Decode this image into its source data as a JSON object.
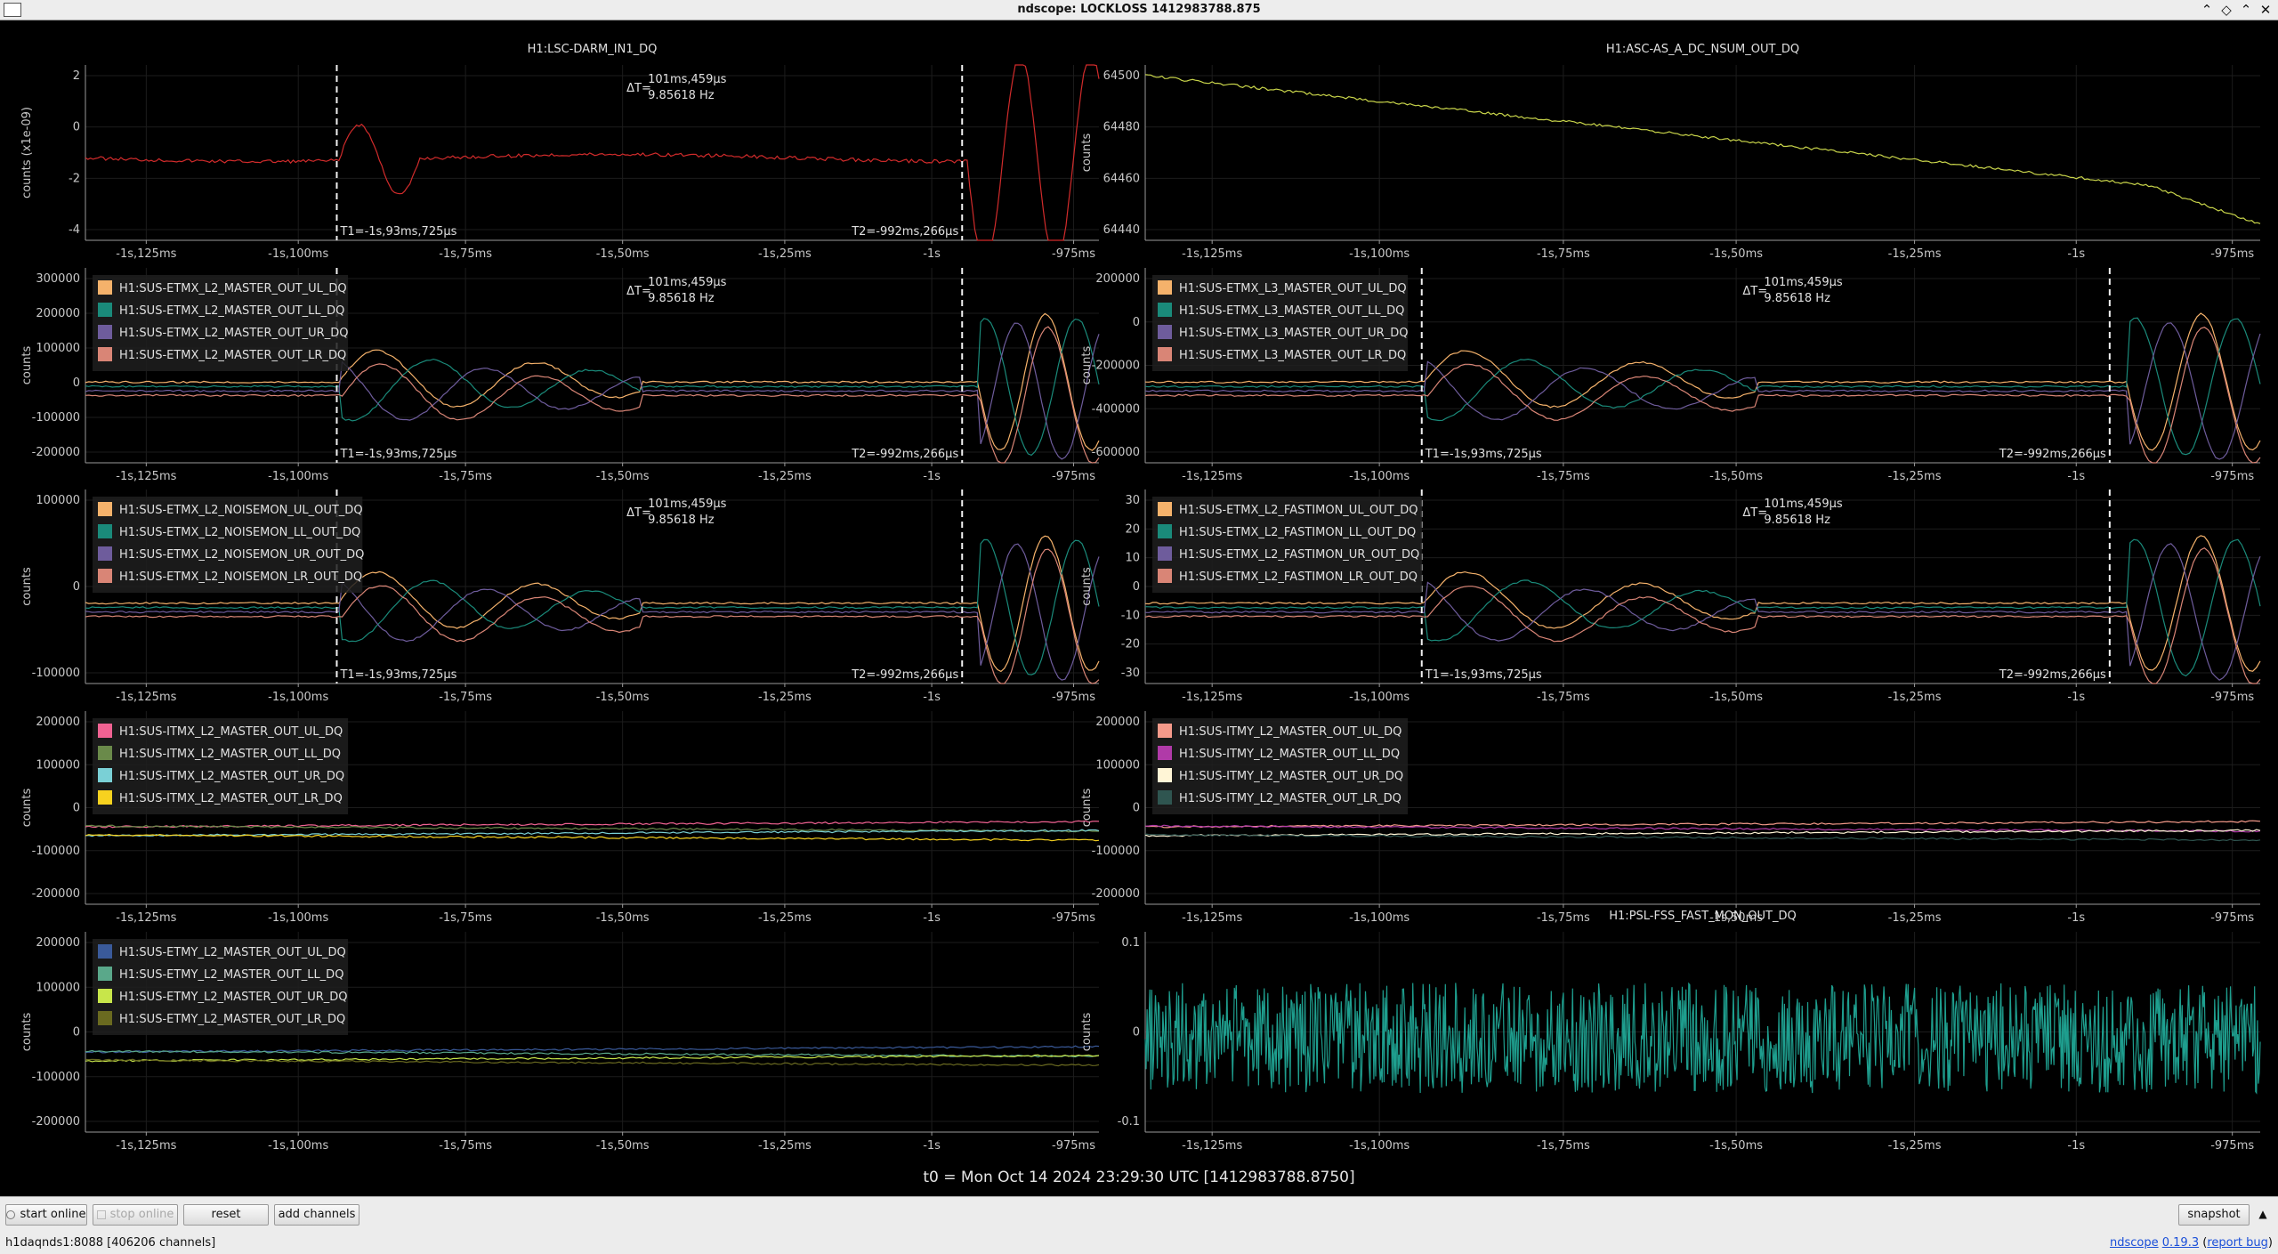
{
  "window": {
    "title": "ndscope: LOCKLOSS 1412983788.875"
  },
  "xticks": [
    "-1s,125ms",
    "-1s,100ms",
    "-1s,75ms",
    "-1s,50ms",
    "-1s,25ms",
    "-1s",
    "-975ms"
  ],
  "cursors": {
    "t1": "T1=-1s,93ms,725µs",
    "t2": "T2=-992ms,266µs",
    "dt_label": "ΔT=",
    "dt_value": "101ms,459µs",
    "freq": "9.85618 Hz"
  },
  "ylabel": "counts",
  "plots": [
    {
      "title": "H1:LSC-DARM_IN1_DQ",
      "ylabel": "counts (x1e-09)",
      "yticks": [
        "2",
        "0",
        "-2",
        "-4"
      ],
      "cursors": true,
      "legend": []
    },
    {
      "title": "H1:ASC-AS_A_DC_NSUM_OUT_DQ",
      "ylabel": "counts",
      "yticks": [
        "64500",
        "64480",
        "64460",
        "64440"
      ],
      "cursors": false,
      "legend": []
    },
    {
      "title": "",
      "ylabel": "counts",
      "yticks": [
        "300000",
        "200000",
        "100000",
        "0",
        "-100000",
        "-200000"
      ],
      "cursors": true,
      "legend": [
        {
          "name": "H1:SUS-ETMX_L2_MASTER_OUT_UL_DQ",
          "color": "#f5b26b"
        },
        {
          "name": "H1:SUS-ETMX_L2_MASTER_OUT_LL_DQ",
          "color": "#1a8a7a"
        },
        {
          "name": "H1:SUS-ETMX_L2_MASTER_OUT_UR_DQ",
          "color": "#6e5c9c"
        },
        {
          "name": "H1:SUS-ETMX_L2_MASTER_OUT_LR_DQ",
          "color": "#d98576"
        }
      ]
    },
    {
      "title": "",
      "ylabel": "counts",
      "yticks": [
        "200000",
        "0",
        "-200000",
        "-400000",
        "-600000"
      ],
      "cursors": true,
      "legend": [
        {
          "name": "H1:SUS-ETMX_L3_MASTER_OUT_UL_DQ",
          "color": "#f5b26b"
        },
        {
          "name": "H1:SUS-ETMX_L3_MASTER_OUT_LL_DQ",
          "color": "#1a8a7a"
        },
        {
          "name": "H1:SUS-ETMX_L3_MASTER_OUT_UR_DQ",
          "color": "#6e5c9c"
        },
        {
          "name": "H1:SUS-ETMX_L3_MASTER_OUT_LR_DQ",
          "color": "#d98576"
        }
      ]
    },
    {
      "title": "",
      "ylabel": "counts",
      "yticks": [
        "100000",
        "0",
        "-100000"
      ],
      "cursors": true,
      "legend": [
        {
          "name": "H1:SUS-ETMX_L2_NOISEMON_UL_OUT_DQ",
          "color": "#f5b26b"
        },
        {
          "name": "H1:SUS-ETMX_L2_NOISEMON_LL_OUT_DQ",
          "color": "#1a8a7a"
        },
        {
          "name": "H1:SUS-ETMX_L2_NOISEMON_UR_OUT_DQ",
          "color": "#6e5c9c"
        },
        {
          "name": "H1:SUS-ETMX_L2_NOISEMON_LR_OUT_DQ",
          "color": "#d98576"
        }
      ]
    },
    {
      "title": "",
      "ylabel": "counts",
      "yticks": [
        "30",
        "20",
        "10",
        "0",
        "-10",
        "-20",
        "-30"
      ],
      "cursors": true,
      "legend": [
        {
          "name": "H1:SUS-ETMX_L2_FASTIMON_UL_OUT_DQ",
          "color": "#f5b26b"
        },
        {
          "name": "H1:SUS-ETMX_L2_FASTIMON_LL_OUT_DQ",
          "color": "#1a8a7a"
        },
        {
          "name": "H1:SUS-ETMX_L2_FASTIMON_UR_OUT_DQ",
          "color": "#6e5c9c"
        },
        {
          "name": "H1:SUS-ETMX_L2_FASTIMON_LR_OUT_DQ",
          "color": "#d98576"
        }
      ]
    },
    {
      "title": "",
      "ylabel": "counts",
      "yticks": [
        "200000",
        "100000",
        "0",
        "-100000",
        "-200000"
      ],
      "cursors": false,
      "legend": [
        {
          "name": "H1:SUS-ITMX_L2_MASTER_OUT_UL_DQ",
          "color": "#f06292"
        },
        {
          "name": "H1:SUS-ITMX_L2_MASTER_OUT_LL_DQ",
          "color": "#6a8a4a"
        },
        {
          "name": "H1:SUS-ITMX_L2_MASTER_OUT_UR_DQ",
          "color": "#7ad0d6"
        },
        {
          "name": "H1:SUS-ITMX_L2_MASTER_OUT_LR_DQ",
          "color": "#f7d21f"
        }
      ]
    },
    {
      "title": "",
      "ylabel": "counts",
      "yticks": [
        "200000",
        "100000",
        "0",
        "-100000",
        "-200000"
      ],
      "cursors": false,
      "legend": [
        {
          "name": "H1:SUS-ITMY_L2_MASTER_OUT_UL_DQ",
          "color": "#f59a8a"
        },
        {
          "name": "H1:SUS-ITMY_L2_MASTER_OUT_LL_DQ",
          "color": "#b03aa8"
        },
        {
          "name": "H1:SUS-ITMY_L2_MASTER_OUT_UR_DQ",
          "color": "#fff5d6"
        },
        {
          "name": "H1:SUS-ITMY_L2_MASTER_OUT_LR_DQ",
          "color": "#2f5550"
        }
      ]
    },
    {
      "title": "",
      "ylabel": "counts",
      "yticks": [
        "200000",
        "100000",
        "0",
        "-100000",
        "-200000"
      ],
      "cursors": false,
      "legend": [
        {
          "name": "H1:SUS-ETMY_L2_MASTER_OUT_UL_DQ",
          "color": "#3a5a9a"
        },
        {
          "name": "H1:SUS-ETMY_L2_MASTER_OUT_LL_DQ",
          "color": "#5aa88a"
        },
        {
          "name": "H1:SUS-ETMY_L2_MASTER_OUT_UR_DQ",
          "color": "#c8e64a"
        },
        {
          "name": "H1:SUS-ETMY_L2_MASTER_OUT_LR_DQ",
          "color": "#6a6a20"
        }
      ]
    },
    {
      "title": "H1:PSL-FSS_FAST_MON_OUT_DQ",
      "ylabel": "counts",
      "yticks": [
        "0.1",
        "0",
        "-0.1"
      ],
      "cursors": false,
      "legend": []
    }
  ],
  "t0": "t0 = Mon Oct 14 2024 23:29:30 UTC [1412983788.8750]",
  "toolbar": {
    "start_online": "start online",
    "stop_online": "stop online",
    "reset": "reset",
    "add_channels": "add channels",
    "snapshot": "snapshot"
  },
  "status": {
    "server": "h1daqnds1:8088",
    "channels": "[406206 channels]",
    "app": "ndscope",
    "version": "0.19.3",
    "report_bug": "report bug"
  }
}
